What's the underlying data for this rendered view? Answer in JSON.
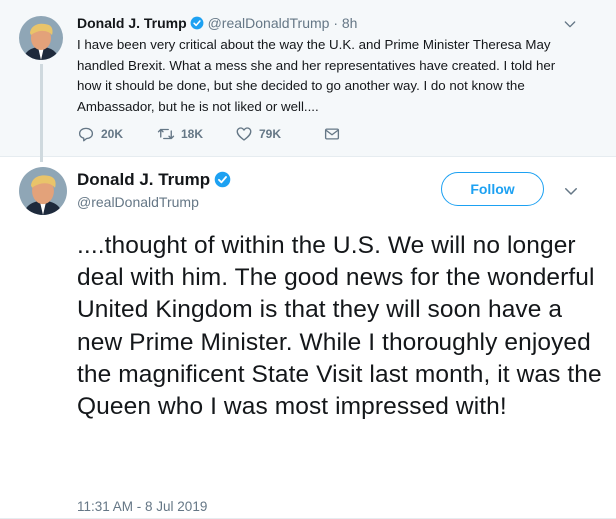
{
  "parent_tweet": {
    "name": "Donald J. Trump",
    "handle": "@realDonaldTrump",
    "separator": "·",
    "time": "8h",
    "text": "I have been very critical about the way the U.K. and Prime Minister Theresa May handled Brexit. What a mess she and her representatives have created. I told her how it should be done, but she decided to go another way. I do not know the Ambassador, but he is not liked or well....",
    "stats": {
      "replies": "20K",
      "retweets": "18K",
      "likes": "79K"
    },
    "icons": [
      "verified-badge-icon",
      "chevron-down-icon",
      "reply-icon",
      "retweet-icon",
      "like-icon",
      "message-icon"
    ]
  },
  "main_tweet": {
    "name": "Donald J. Trump",
    "handle": "@realDonaldTrump",
    "follow_label": "Follow",
    "text": "....thought of within the U.S. We will no longer deal with him. The good news for the wonderful United Kingdom is that they will soon have a new Prime Minister. While I thoroughly enjoyed the magnificent State Visit last month, it was the Queen who I was most impressed with!",
    "timestamp": "11:31 AM - 8 Jul 2019"
  },
  "colors": {
    "accent": "#1da1f2",
    "secondary_text": "#657786",
    "parent_background": "#f5f8fa",
    "thread_line": "#cfd9de"
  }
}
